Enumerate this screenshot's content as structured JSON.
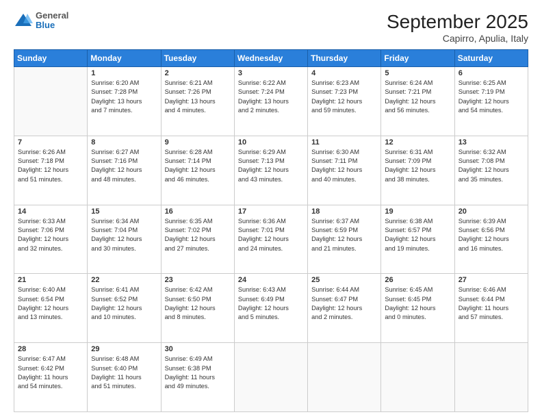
{
  "header": {
    "logo_general": "General",
    "logo_blue": "Blue",
    "title": "September 2025",
    "subtitle": "Capirro, Apulia, Italy"
  },
  "days_of_week": [
    "Sunday",
    "Monday",
    "Tuesday",
    "Wednesday",
    "Thursday",
    "Friday",
    "Saturday"
  ],
  "weeks": [
    [
      {
        "day": "",
        "info": ""
      },
      {
        "day": "1",
        "info": "Sunrise: 6:20 AM\nSunset: 7:28 PM\nDaylight: 13 hours\nand 7 minutes."
      },
      {
        "day": "2",
        "info": "Sunrise: 6:21 AM\nSunset: 7:26 PM\nDaylight: 13 hours\nand 4 minutes."
      },
      {
        "day": "3",
        "info": "Sunrise: 6:22 AM\nSunset: 7:24 PM\nDaylight: 13 hours\nand 2 minutes."
      },
      {
        "day": "4",
        "info": "Sunrise: 6:23 AM\nSunset: 7:23 PM\nDaylight: 12 hours\nand 59 minutes."
      },
      {
        "day": "5",
        "info": "Sunrise: 6:24 AM\nSunset: 7:21 PM\nDaylight: 12 hours\nand 56 minutes."
      },
      {
        "day": "6",
        "info": "Sunrise: 6:25 AM\nSunset: 7:19 PM\nDaylight: 12 hours\nand 54 minutes."
      }
    ],
    [
      {
        "day": "7",
        "info": "Sunrise: 6:26 AM\nSunset: 7:18 PM\nDaylight: 12 hours\nand 51 minutes."
      },
      {
        "day": "8",
        "info": "Sunrise: 6:27 AM\nSunset: 7:16 PM\nDaylight: 12 hours\nand 48 minutes."
      },
      {
        "day": "9",
        "info": "Sunrise: 6:28 AM\nSunset: 7:14 PM\nDaylight: 12 hours\nand 46 minutes."
      },
      {
        "day": "10",
        "info": "Sunrise: 6:29 AM\nSunset: 7:13 PM\nDaylight: 12 hours\nand 43 minutes."
      },
      {
        "day": "11",
        "info": "Sunrise: 6:30 AM\nSunset: 7:11 PM\nDaylight: 12 hours\nand 40 minutes."
      },
      {
        "day": "12",
        "info": "Sunrise: 6:31 AM\nSunset: 7:09 PM\nDaylight: 12 hours\nand 38 minutes."
      },
      {
        "day": "13",
        "info": "Sunrise: 6:32 AM\nSunset: 7:08 PM\nDaylight: 12 hours\nand 35 minutes."
      }
    ],
    [
      {
        "day": "14",
        "info": "Sunrise: 6:33 AM\nSunset: 7:06 PM\nDaylight: 12 hours\nand 32 minutes."
      },
      {
        "day": "15",
        "info": "Sunrise: 6:34 AM\nSunset: 7:04 PM\nDaylight: 12 hours\nand 30 minutes."
      },
      {
        "day": "16",
        "info": "Sunrise: 6:35 AM\nSunset: 7:02 PM\nDaylight: 12 hours\nand 27 minutes."
      },
      {
        "day": "17",
        "info": "Sunrise: 6:36 AM\nSunset: 7:01 PM\nDaylight: 12 hours\nand 24 minutes."
      },
      {
        "day": "18",
        "info": "Sunrise: 6:37 AM\nSunset: 6:59 PM\nDaylight: 12 hours\nand 21 minutes."
      },
      {
        "day": "19",
        "info": "Sunrise: 6:38 AM\nSunset: 6:57 PM\nDaylight: 12 hours\nand 19 minutes."
      },
      {
        "day": "20",
        "info": "Sunrise: 6:39 AM\nSunset: 6:56 PM\nDaylight: 12 hours\nand 16 minutes."
      }
    ],
    [
      {
        "day": "21",
        "info": "Sunrise: 6:40 AM\nSunset: 6:54 PM\nDaylight: 12 hours\nand 13 minutes."
      },
      {
        "day": "22",
        "info": "Sunrise: 6:41 AM\nSunset: 6:52 PM\nDaylight: 12 hours\nand 10 minutes."
      },
      {
        "day": "23",
        "info": "Sunrise: 6:42 AM\nSunset: 6:50 PM\nDaylight: 12 hours\nand 8 minutes."
      },
      {
        "day": "24",
        "info": "Sunrise: 6:43 AM\nSunset: 6:49 PM\nDaylight: 12 hours\nand 5 minutes."
      },
      {
        "day": "25",
        "info": "Sunrise: 6:44 AM\nSunset: 6:47 PM\nDaylight: 12 hours\nand 2 minutes."
      },
      {
        "day": "26",
        "info": "Sunrise: 6:45 AM\nSunset: 6:45 PM\nDaylight: 12 hours\nand 0 minutes."
      },
      {
        "day": "27",
        "info": "Sunrise: 6:46 AM\nSunset: 6:44 PM\nDaylight: 11 hours\nand 57 minutes."
      }
    ],
    [
      {
        "day": "28",
        "info": "Sunrise: 6:47 AM\nSunset: 6:42 PM\nDaylight: 11 hours\nand 54 minutes."
      },
      {
        "day": "29",
        "info": "Sunrise: 6:48 AM\nSunset: 6:40 PM\nDaylight: 11 hours\nand 51 minutes."
      },
      {
        "day": "30",
        "info": "Sunrise: 6:49 AM\nSunset: 6:38 PM\nDaylight: 11 hours\nand 49 minutes."
      },
      {
        "day": "",
        "info": ""
      },
      {
        "day": "",
        "info": ""
      },
      {
        "day": "",
        "info": ""
      },
      {
        "day": "",
        "info": ""
      }
    ]
  ]
}
